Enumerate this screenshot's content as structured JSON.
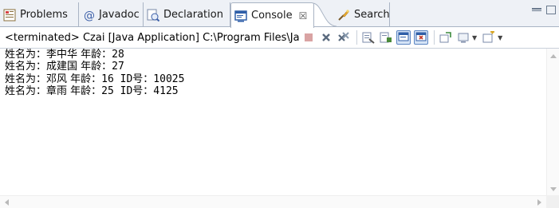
{
  "tabs": [
    {
      "label": "Problems",
      "icon": "problems-icon"
    },
    {
      "label": "Javadoc",
      "icon": "javadoc-icon"
    },
    {
      "label": "Declaration",
      "icon": "declaration-icon"
    },
    {
      "label": "Console",
      "icon": "console-icon",
      "active": true,
      "close": "☒"
    },
    {
      "label": "Search",
      "icon": "search-icon"
    }
  ],
  "toolbar": {
    "title": "<terminated> Czai [Java Application] C:\\Program Files\\Ja"
  },
  "console": {
    "lines": [
      {
        "cjk": "姓名为：李中华 年龄：",
        "mono": "28"
      },
      {
        "cjk": "姓名为：成建国 年龄：",
        "mono": "27"
      },
      {
        "cjk": "姓名为：邓风 年龄：",
        "mono": "16 ID",
        "cjk2": "号：",
        "mono2": "10025"
      },
      {
        "cjk": "姓名为：章雨 年龄：",
        "mono": "25 ID",
        "cjk2": "号：",
        "mono2": "4125"
      }
    ]
  },
  "colors": {
    "tab_strip": "#eef1f6",
    "border": "#a9b4c4",
    "pressed": "#d5e3f6",
    "terminate_red": "#c0392b"
  }
}
